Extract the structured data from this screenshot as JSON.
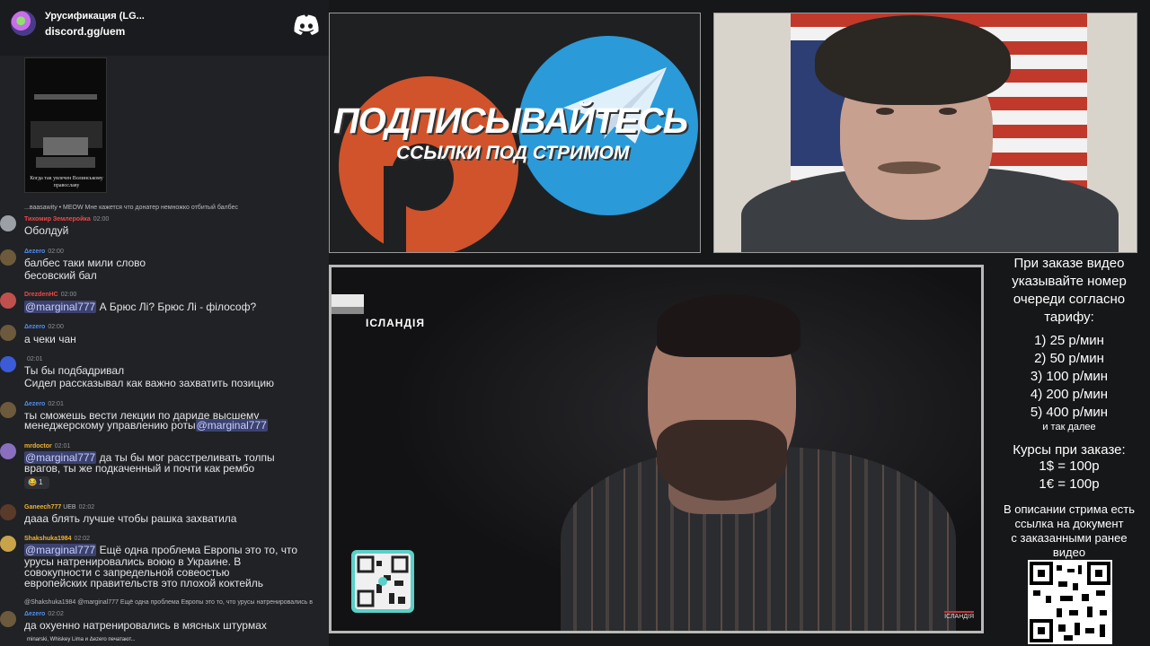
{
  "chat": {
    "server_name": "Урусификация (LG...",
    "server_invite": "discord.gg/uem",
    "image_caption": "Когда так увлечен Волинському православу",
    "messages": [
      {
        "reply": "...ваasawity • MEOW Мне кажется что донатер немножко отбитый балбес",
        "author": "Тихомир Землеройка",
        "author_color": "#f04747",
        "time": "02:00",
        "lines": [
          "Оболдуй"
        ]
      },
      {
        "author": "Δezero",
        "author_color": "#4f8ff0",
        "time": "02:00",
        "lines": [
          "балбес таки мили слово",
          "бесовский бал"
        ]
      },
      {
        "author": "DrezdenHC",
        "author_color": "#f04747",
        "time": "02:00",
        "mention": "@marginal777",
        "lines": [
          "А Брюс Лі? Брюс Лі - філософ?"
        ]
      },
      {
        "author": "Δezero",
        "author_color": "#4f8ff0",
        "time": "02:00",
        "lines": [
          "а чеки чан"
        ]
      },
      {
        "author": "",
        "author_color": "#b9bbbe",
        "time": "02:01",
        "lines": [
          "Ты бы подбадривал",
          "Сидел рассказывал как важно захватить позицию"
        ]
      },
      {
        "author": "Δezero",
        "author_color": "#4f8ff0",
        "time": "02:01",
        "lines": [
          "ты сможешь вести лекции по дариде высшему",
          "менеджерскому управлению роты"
        ],
        "mention_end": "@marginal777"
      },
      {
        "author": "mrdoctor",
        "author_color": "#f0b232",
        "time": "02:01",
        "mention": "@marginal777",
        "lines": [
          "да ты бы мог расстреливать толпы",
          "врагов, ты же подкаченный и почти как рембо"
        ],
        "reaction": "😂 1"
      },
      {
        "author": "Ganeech777",
        "author_color": "#f0b232",
        "badge": "UEB",
        "time": "02:02",
        "lines": [
          "дааа блять лучше чтобы рашка захватила"
        ]
      },
      {
        "author": "Shakshuka1984",
        "author_color": "#f0b232",
        "time": "02:02",
        "mention": "@marginal777",
        "lines": [
          "Ещё одна проблема Европы это то, что",
          "урусы натренировались воюю в Украине. В",
          "совокупности с запредельной совеостью",
          "европейских правительств это плохой коктейль"
        ]
      },
      {
        "reply": "@Shakshuka1984 @marginal777 Ещё одна проблема Европы это то, что урусы натренировались в",
        "author": "Δezero",
        "author_color": "#4f8ff0",
        "time": "02:02",
        "lines": [
          "да охуенно натренировались в мясных штурмах"
        ]
      }
    ],
    "typing": "minarski, Whiskey Lima и Δezero печатают..."
  },
  "promo": {
    "title": "ПОДПИСЫВАЙТЕСЬ",
    "subtitle": "ССЫЛКИ ПОД СТРИМОМ"
  },
  "video": {
    "country_label": "ІСЛАНДІЯ",
    "logo": "ІСЛАНДІЯ"
  },
  "price_panel": {
    "heading": [
      "При заказе видео",
      "указывайте номер",
      "очереди согласно",
      "тарифу:"
    ],
    "tariffs": [
      "1) 25 р/мин",
      "2) 50 р/мин",
      "3) 100 р/мин",
      "4) 200 р/мин",
      "5) 400 р/мин"
    ],
    "etc": "и так далее",
    "rates_title": "Курсы при заказе:",
    "rates": [
      "1$ = 100р",
      "1€ = 100р"
    ],
    "description": [
      "В описании стрима есть",
      "ссылка на документ",
      "с заказанными ранее",
      "видео"
    ]
  }
}
